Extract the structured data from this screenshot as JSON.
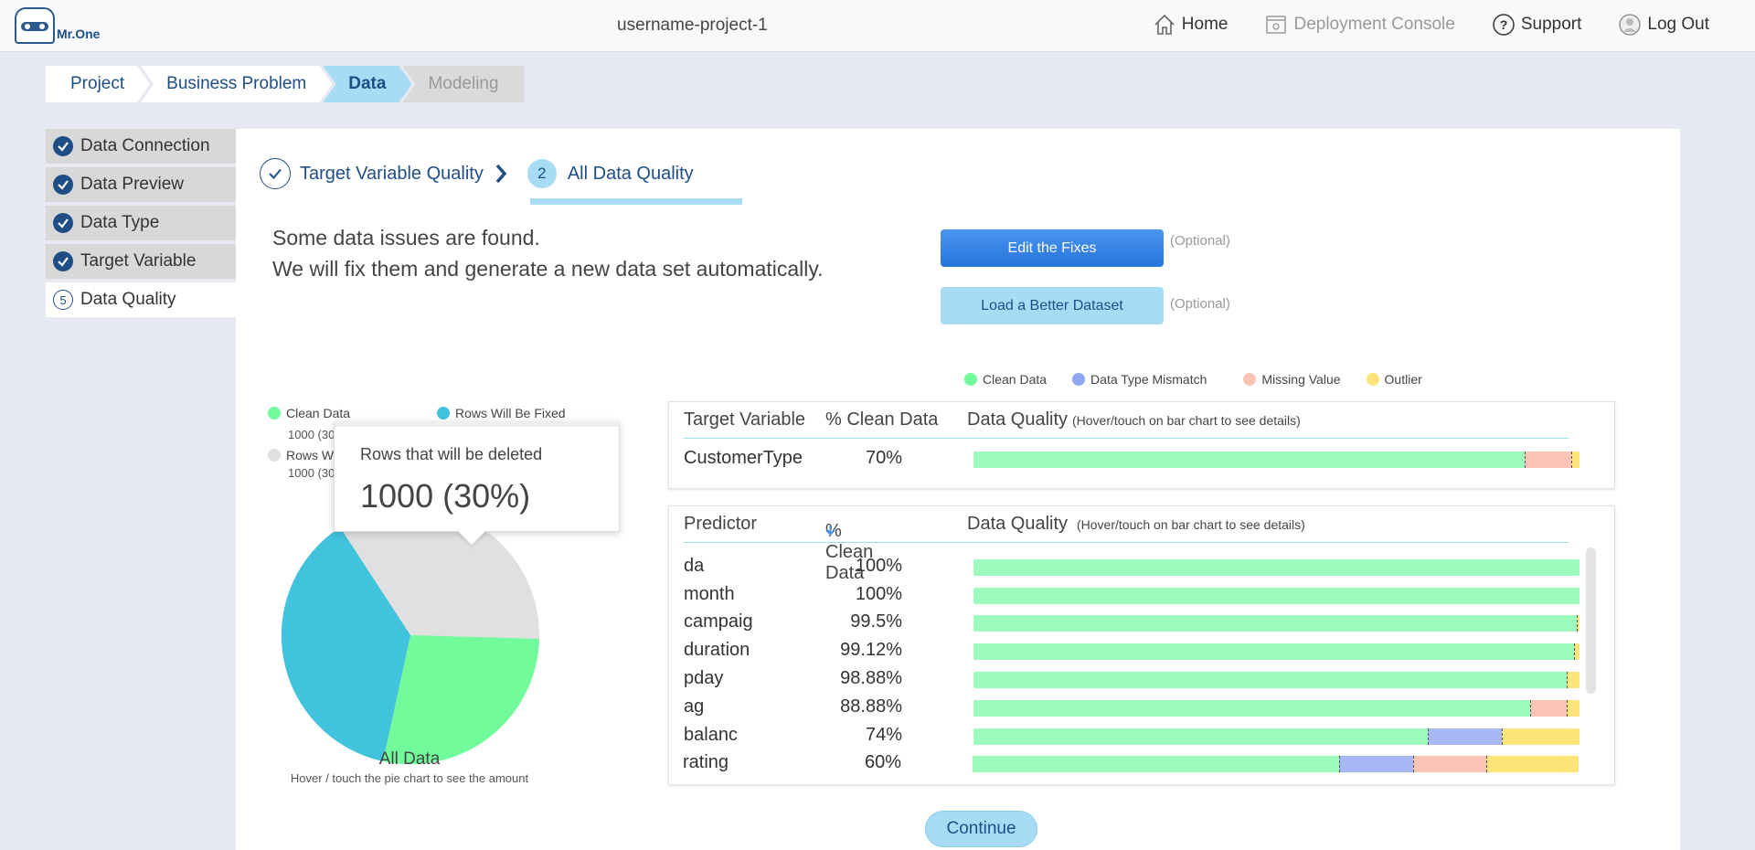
{
  "header": {
    "logo_text": "Mr.One",
    "project_name": "username-project-1",
    "nav": {
      "home": "Home",
      "deployment": "Deployment Console",
      "support": "Support",
      "logout": "Log Out"
    }
  },
  "breadcrumbs": [
    "Project",
    "Business Problem",
    "Data",
    "Modeling"
  ],
  "sidebar": {
    "items": [
      {
        "label": "Data Connection",
        "done": true
      },
      {
        "label": "Data Preview",
        "done": true
      },
      {
        "label": "Data Type",
        "done": true
      },
      {
        "label": "Target Variable",
        "done": true
      },
      {
        "label": "Data Quality",
        "done": false,
        "step": "5"
      }
    ]
  },
  "subtabs": {
    "first": "Target Variable Quality",
    "second_num": "2",
    "second": "All Data Quality"
  },
  "message": {
    "line1": "Some data issues are found.",
    "line2": "We will fix them and generate a new data set automatically."
  },
  "actions": {
    "edit_fixes": "Edit the Fixes",
    "load_better": "Load a Better Dataset",
    "optional": "(Optional)"
  },
  "pie": {
    "legend_clean": "Clean Data",
    "legend_fixed": "Rows Will Be Fixed",
    "legend_deleted_partial": "Rows W",
    "clean_amount_partial": "1000 (30",
    "deleted_amount_partial": "1000 (30",
    "title": "All Data",
    "hint": "Hover / touch the pie chart to see the amount",
    "tooltip_label": "Rows that will be deleted",
    "tooltip_value": "1000 (30%)"
  },
  "quality_legend": {
    "clean": "Clean Data",
    "mismatch": "Data Type Mismatch",
    "missing": "Missing Value",
    "outlier": "Outlier"
  },
  "target_card": {
    "col_name": "Target Variable",
    "col_pct": "% Clean Data",
    "col_quality": "Data Quality",
    "hint": "(Hover/touch on bar chart to see details)",
    "row": {
      "name": "CustomerType",
      "pct": "70%"
    }
  },
  "predictor_card": {
    "col_name": "Predictor",
    "col_pct": "% Clean Data",
    "col_quality": "Data Quality",
    "hint": "(Hover/touch on bar chart to see details)",
    "rows": [
      {
        "name": "da",
        "pct": "100%"
      },
      {
        "name": "month",
        "pct": "100%"
      },
      {
        "name": "campaig",
        "pct": "99.5%"
      },
      {
        "name": "duration",
        "pct": "99.12%"
      },
      {
        "name": "pday",
        "pct": "98.88%"
      },
      {
        "name": "ag",
        "pct": "88.88%"
      },
      {
        "name": "balanc",
        "pct": "74%"
      },
      {
        "name": "rating",
        "pct": "60%"
      }
    ]
  },
  "continue_label": "Continue",
  "colors": {
    "clean": "#9dfcbd",
    "mismatch": "#a9b7f5",
    "missing": "#f9c4b5",
    "outlier": "#fbe47a",
    "pie_clean": "#71fb9a",
    "pie_fixed": "#41c3de",
    "pie_deleted": "#e0e0e0"
  }
}
